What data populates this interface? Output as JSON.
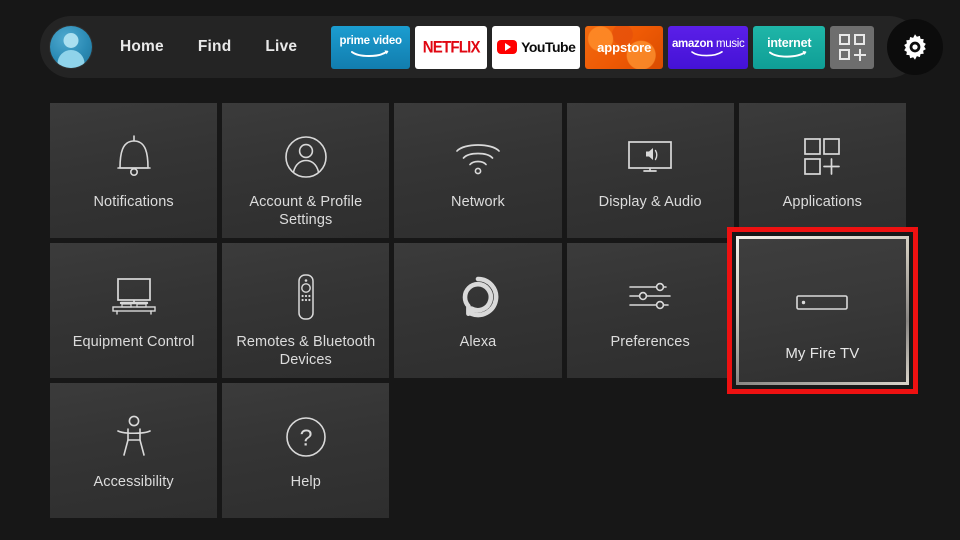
{
  "nav": {
    "avatar_name": "profile-avatar",
    "links": [
      {
        "label": "Home"
      },
      {
        "label": "Find"
      },
      {
        "label": "Live"
      }
    ],
    "apps": [
      {
        "id": "prime-video",
        "label": "prime video",
        "color": "#1b9dd0"
      },
      {
        "id": "netflix",
        "label": "NETFLIX",
        "color": "#e00712"
      },
      {
        "id": "youtube",
        "label": "YouTube",
        "color": "#ff0000"
      },
      {
        "id": "appstore",
        "label": "appstore",
        "color": "#ef5a05"
      },
      {
        "id": "amazon-music",
        "label_bold": "amazon",
        "label_light": "music",
        "color": "#4412d6"
      },
      {
        "id": "internet",
        "label": "internet",
        "color": "#0f9e96"
      },
      {
        "id": "app-library",
        "label": "",
        "color": "#6e6e6e"
      }
    ],
    "settings_button": "gear-icon"
  },
  "settings_grid": {
    "selected_tile": "My Fire TV",
    "highlight_color": "#ee1111",
    "tiles": [
      {
        "icon": "bell-icon",
        "label": "Notifications"
      },
      {
        "icon": "person-circle-icon",
        "label": "Account & Profile Settings"
      },
      {
        "icon": "wifi-icon",
        "label": "Network"
      },
      {
        "icon": "tv-speaker-icon",
        "label": "Display & Audio"
      },
      {
        "icon": "apps-grid-plus-icon",
        "label": "Applications"
      },
      {
        "icon": "tv-stand-icon",
        "label": "Equipment Control"
      },
      {
        "icon": "remote-icon",
        "label": "Remotes & Bluetooth Devices"
      },
      {
        "icon": "alexa-ring-icon",
        "label": "Alexa"
      },
      {
        "icon": "sliders-icon",
        "label": "Preferences"
      },
      {
        "icon": "firetv-stick-icon",
        "label": "My Fire TV"
      },
      {
        "icon": "accessibility-icon",
        "label": "Accessibility"
      },
      {
        "icon": "question-circle-icon",
        "label": "Help"
      }
    ]
  }
}
